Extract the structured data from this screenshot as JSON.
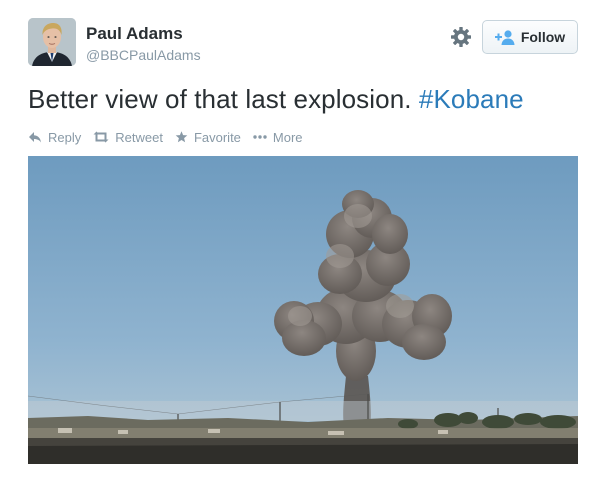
{
  "user": {
    "name": "Paul Adams",
    "handle": "@BBCPaulAdams"
  },
  "follow_button": {
    "label": "Follow"
  },
  "tweet": {
    "text": "Better view of that last explosion.",
    "hashtag": "#Kobane"
  },
  "actions": [
    {
      "label": "Reply",
      "icon": "reply-icon"
    },
    {
      "label": "Retweet",
      "icon": "retweet-icon"
    },
    {
      "label": "Favorite",
      "icon": "star-icon"
    },
    {
      "label": "More",
      "icon": "more-dots-icon"
    }
  ],
  "colors": {
    "hashtag_blue": "#2b7bb9",
    "muted_gray": "#8899a6",
    "text_dark": "#292f33",
    "follow_icon_blue": "#55acee"
  }
}
